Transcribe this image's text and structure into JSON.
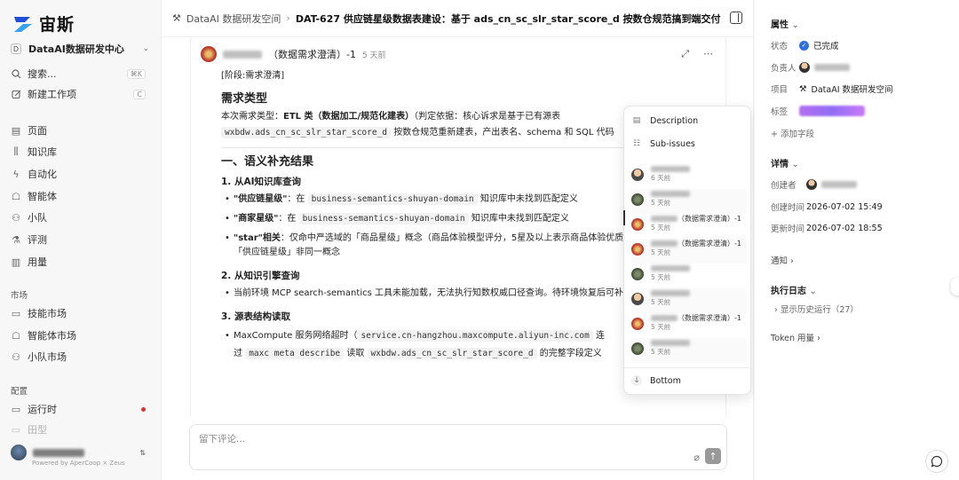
{
  "app": {
    "brand": "宙斯",
    "workspace_badge": "D",
    "workspace_name": "DataAI数据研发中心",
    "powered_by": "Powered by AperCoop × Zeus"
  },
  "sidebar": {
    "search_label": "搜索...",
    "search_shortcut": "⌘K",
    "new_label": "新建工作项",
    "new_shortcut": "C",
    "main_items": [
      "页面",
      "知识库",
      "自动化",
      "智能体",
      "小队",
      "评测",
      "用量"
    ],
    "market_title": "市场",
    "market_items": [
      "技能市场",
      "智能体市场",
      "小队市场"
    ],
    "config_title": "配置",
    "config_items": [
      "运行时",
      "田型"
    ]
  },
  "header": {
    "space": "DataAI 数据研发空间",
    "title": "DAT-627 供应链星级数据表建设：基于 ads_cn_sc_slr_star_score_d 按数仓规范搞到端交付"
  },
  "comment": {
    "author_suffix": "（数据需求澄清）-1",
    "time": "5 天前",
    "stage": "[阶段:需求澄清]",
    "h_type": "需求类型",
    "type_line_pre": "本次需求类型：",
    "type_strong": "ETL 类（数据加工/规范化建表）",
    "type_line_post": "（判定依据：核心诉求是基于已有源表",
    "type_code": "wxbdw.ads_cn_sc_slr_star_score_d",
    "type_line2": "按数仓规范重新建表，产出表名、schema 和 SQL 代码",
    "h_sem": "一、语义补充结果",
    "h_kb": "1. 从AI知识库查询",
    "b1_strong": "\"供应链星级\"",
    "b1_pre": "：在",
    "b1_code": "business-semantics-shuyan-domain",
    "b1_post": "知识库中未找到匹配定义",
    "b2_strong": "\"商家星级\"",
    "b2_pre": "：在",
    "b2_code": "business-semantics-shuyan-domain",
    "b2_post": "知识库中未找到匹配定义",
    "b3_strong": "\"star\"相关",
    "b3_text": "：仅命中严选域的「商品星级」概念（商品体验模型评分，5星及以上表示商品体验优质",
    "b3_text2": "「供应链星级」非同一概念",
    "h_eng": "2. 从知识引擎查询",
    "e1": "当前环境 MCP search-semantics 工具未能加载，无法执行知数权威口径查询。待环境恢复后可补",
    "h_src": "3. 源表结构读取",
    "s1_pre": "MaxCompute 服务网络超时（",
    "s1_code": "service.cn-hangzhou.maxcompute.aliyun-inc.com",
    "s1_post": "连",
    "s2_pre": "过",
    "s2_code1": "maxc meta describe",
    "s2_mid": "读取",
    "s2_code2": "wxbdw.ads_cn_sc_slr_star_score_d",
    "s2_post": "的完整字段定义"
  },
  "composer": {
    "placeholder": "留下评论..."
  },
  "popup": {
    "description": "Description",
    "subissues": "Sub-issues",
    "bottom": "Bottom",
    "items": [
      {
        "line": "",
        "time": "6 天前",
        "avatar": "person"
      },
      {
        "line": "",
        "time": "5 天前",
        "avatar": "dark"
      },
      {
        "line": "（数据需求澄清）-1",
        "time": "5 天前",
        "avatar": "red"
      },
      {
        "line": "（数据需求澄清）-1",
        "time": "5 天前",
        "avatar": "red"
      },
      {
        "line": "",
        "time": "5 天前",
        "avatar": "dark"
      },
      {
        "line": "",
        "time": "5 天前",
        "avatar": "person"
      },
      {
        "line": "（数据需求澄清）-1",
        "time": "5 天前",
        "avatar": "red"
      },
      {
        "line": "",
        "time": "5 天前",
        "avatar": "dark"
      }
    ]
  },
  "right": {
    "attributes": "属性",
    "status_k": "状态",
    "status_v": "已完成",
    "owner_k": "负责人",
    "project_k": "项目",
    "project_v": "DataAI 数据研发空间",
    "tag_k": "标签",
    "add_field": "添加字段",
    "details": "详情",
    "creator_k": "创建者",
    "created_k": "创建时间",
    "created_v": "2026-07-02 15:49",
    "updated_k": "更新时间",
    "updated_v": "2026-07-02 18:55",
    "notify": "通知",
    "exec_log": "执行日志",
    "history": "显示历史运行（27）",
    "token": "Token 用量"
  },
  "colors": {
    "accent": "#2f6fe0",
    "brand": "#1f4fd8",
    "danger": "#e03131"
  }
}
